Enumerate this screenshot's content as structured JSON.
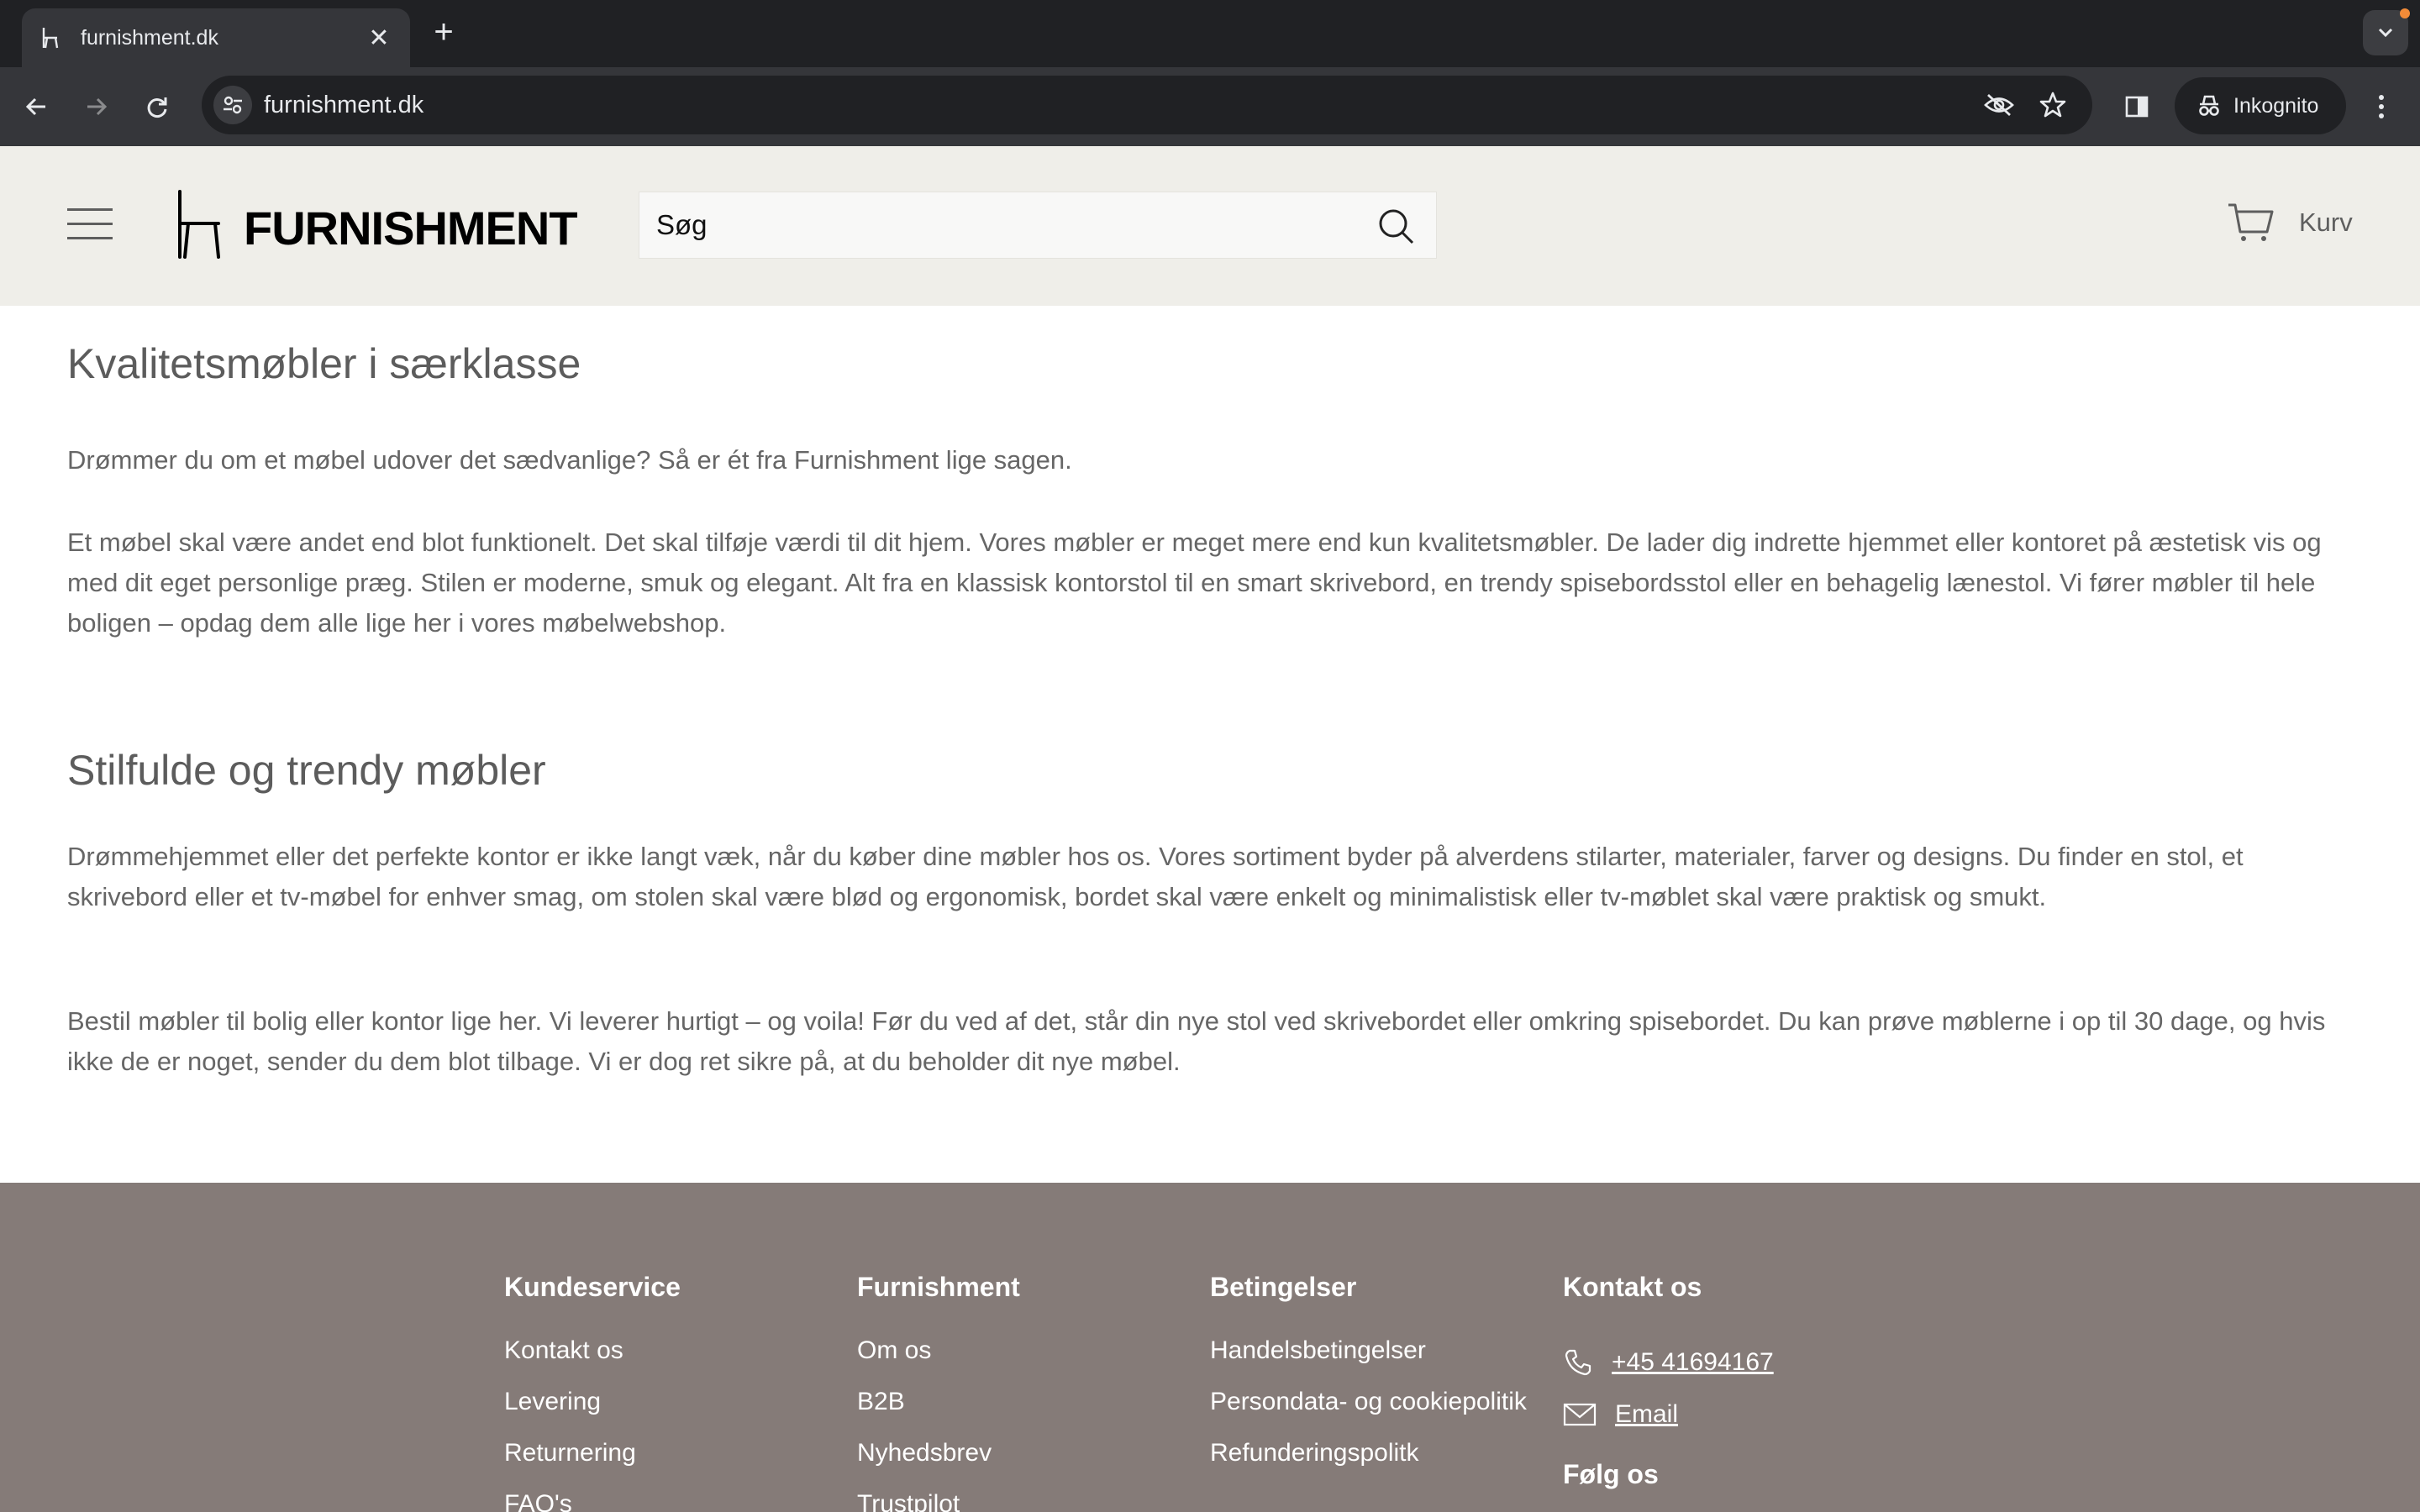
{
  "browser": {
    "tab_title": "furnishment.dk",
    "url": "furnishment.dk",
    "incognito_label": "Inkognito"
  },
  "header": {
    "logo_text": "FURNISHMENT",
    "search_placeholder": "Søg",
    "cart_label": "Kurv"
  },
  "content": {
    "heading1": "Kvalitetsmøbler i særklasse",
    "p1": "Drømmer du om et møbel udover det sædvanlige? Så er ét fra Furnishment lige sagen.",
    "p2": "Et møbel skal være andet end blot funktionelt. Det skal tilføje værdi til dit hjem. Vores møbler er meget mere end kun kvalitetsmøbler. De lader dig indrette hjemmet eller kontoret på æstetisk vis og med dit eget personlige præg. Stilen er moderne, smuk og elegant. Alt fra en klassisk kontorstol til en smart skrivebord, en trendy spisebordsstol eller en behagelig lænestol. Vi fører møbler til hele boligen – opdag dem alle lige her i vores møbelwebshop.",
    "heading2": "Stilfulde og trendy møbler",
    "p3": "Drømmehjemmet eller det perfekte kontor er ikke langt væk, når du køber dine møbler hos os. Vores sortiment byder på alverdens stilarter, materialer, farver og designs. Du finder en stol, et skrivebord eller et tv-møbel for enhver smag, om stolen skal være blød og ergonomisk, bordet skal være enkelt og minimalistisk eller tv-møblet skal være praktisk og smukt.",
    "p4": "Bestil møbler til bolig eller kontor lige her. Vi leverer hurtigt – og voila! Før du ved af det, står din nye stol ved skrivebordet eller omkring spisebordet. Du kan prøve møblerne i op til 30 dage, og hvis ikke de er noget, sender du dem blot tilbage. Vi er dog ret sikre på, at du beholder dit nye møbel."
  },
  "footer": {
    "col1": {
      "title": "Kundeservice",
      "links": [
        "Kontakt os",
        "Levering",
        "Returnering",
        "FAQ's"
      ]
    },
    "col2": {
      "title": "Furnishment",
      "links": [
        "Om os",
        "B2B",
        "Nyhedsbrev",
        "Trustpilot"
      ]
    },
    "col3": {
      "title": "Betingelser",
      "links": [
        "Handelsbetingelser",
        "Persondata- og cookiepolitik",
        "Refunderingspolitk"
      ]
    },
    "col4": {
      "title": "Kontakt os",
      "phone": "+45 41694167",
      "email": "Email",
      "follow": "Følg os"
    }
  },
  "colors": {
    "header_bg": "#efeee9",
    "footer_bg": "#857b78",
    "text": "#666666"
  }
}
